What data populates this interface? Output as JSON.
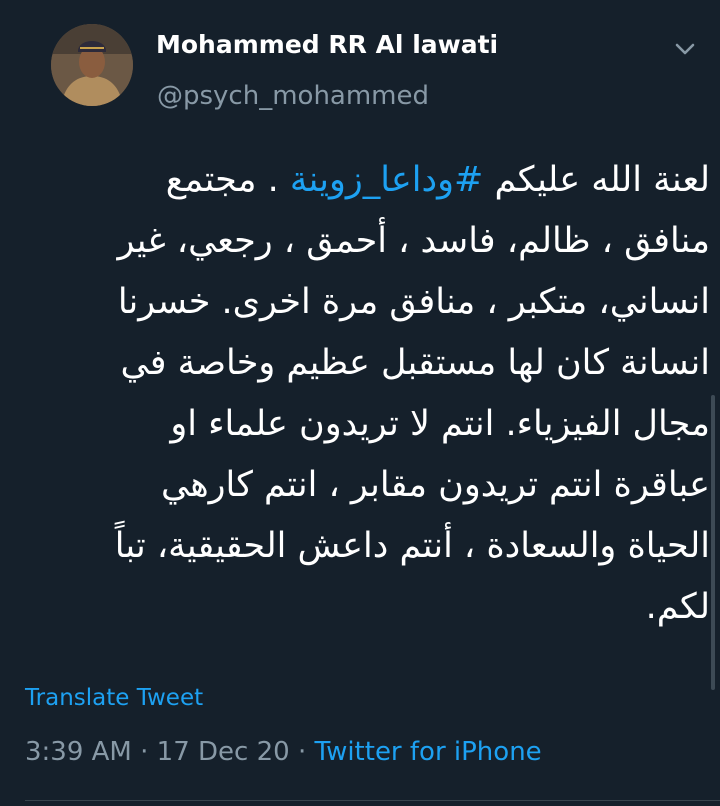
{
  "user": {
    "display_name": "Mohammed RR Al lawati",
    "handle": "@psych_mohammed",
    "avatar_icon": "user-avatar-photo",
    "menu_icon": "chevron-down-icon"
  },
  "tweet": {
    "lines": [
      {
        "before": "لعنة الله عليكم ",
        "hashtag": "#وداعا_زوينة",
        "after": " . مجتمع"
      },
      {
        "text": "منافق ، ظالم، فاسد ، أحمق ، رجعي، غير"
      },
      {
        "text": "انساني، متكبر ، منافق مرة اخرى. خسرنا"
      },
      {
        "text": "انسانة كان لها مستقبل عظيم وخاصة في"
      },
      {
        "text": "مجال الفيزياء. انتم لا تريدون علماء او"
      },
      {
        "text": "عباقرة انتم تريدون مقابر ، انتم كارهي"
      },
      {
        "text": "الحياة والسعادة ، أنتم داعش الحقيقية، تباً"
      },
      {
        "text": "لكم."
      }
    ]
  },
  "translate_label": "Translate Tweet",
  "meta": {
    "time": "3:39 AM",
    "sep1": " · ",
    "date": "17 Dec 20",
    "sep2": " · ",
    "source": "Twitter for iPhone"
  },
  "colors": {
    "background": "#15202b",
    "link": "#1da1f2",
    "secondary_text": "#8899a6"
  }
}
